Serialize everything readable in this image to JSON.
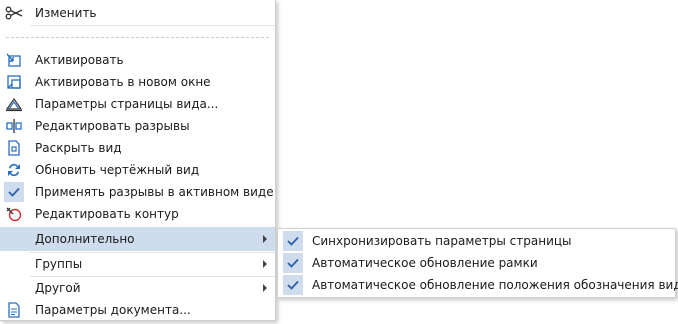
{
  "menu": {
    "edit": "Изменить",
    "items": [
      {
        "label": "Активировать",
        "icon": "activate-icon"
      },
      {
        "label": "Активировать в новом окне",
        "icon": "activate-new-window-icon"
      },
      {
        "label": "Параметры страницы вида...",
        "icon": "view-page-settings-icon"
      },
      {
        "label": "Редактировать разрывы",
        "icon": "edit-breaks-icon"
      },
      {
        "label": "Раскрыть вид",
        "icon": "expand-view-icon"
      },
      {
        "label": "Обновить чертёжный вид",
        "icon": "refresh-drawing-view-icon"
      },
      {
        "label": "Применять разрывы в активном виде",
        "icon": "checkmark-icon"
      },
      {
        "label": "Редактировать контур",
        "icon": "edit-contour-icon"
      }
    ],
    "additional": "Дополнительно",
    "groups": "Группы",
    "other": "Другой",
    "document_settings": "Параметры документа..."
  },
  "submenu": {
    "items": [
      {
        "label": "Синхронизировать параметры страницы",
        "checked": true
      },
      {
        "label": "Автоматическое обновление рамки",
        "checked": true
      },
      {
        "label": "Автоматическое обновление положения обозначения вида",
        "checked": true
      }
    ]
  },
  "colors": {
    "highlight": "#cfdcee",
    "icon_blue": "#2a6fc4",
    "icon_red": "#d03030"
  }
}
